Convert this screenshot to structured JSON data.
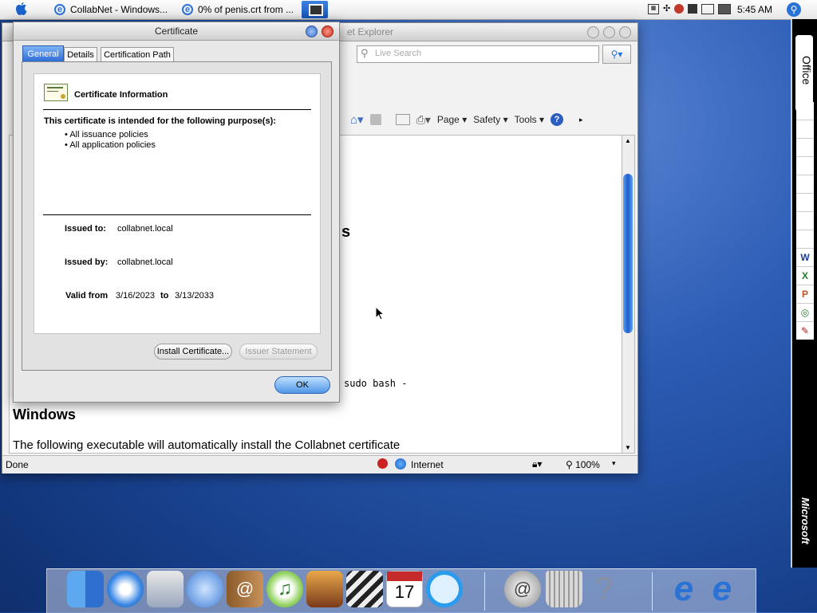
{
  "menubar": {
    "tabs": [
      {
        "label": "CollabNet - Windows..."
      },
      {
        "label": "0% of penis.crt from ..."
      }
    ],
    "clock": "5:45 AM"
  },
  "ie": {
    "title_fragment": "et Explorer",
    "search_placeholder": "Live Search",
    "toolbar": {
      "page": "Page",
      "safety": "Safety",
      "tools": "Tools"
    },
    "page": {
      "heading_fragment": "s",
      "code_fragment": "sudo bash -",
      "windows_heading": "Windows",
      "windows_text": "The following executable will automatically install the Collabnet certificate"
    },
    "status": {
      "left": "Done",
      "zone": "Internet",
      "zoom": "100%"
    }
  },
  "cert": {
    "title": "Certificate",
    "tabs": [
      "General",
      "Details",
      "Certification Path"
    ],
    "info_heading": "Certificate Information",
    "purpose_heading": "This certificate is intended for the following purpose(s):",
    "purposes": [
      "All issuance policies",
      "All application policies"
    ],
    "issued_to_label": "Issued to:",
    "issued_to": "collabnet.local",
    "issued_by_label": "Issued by:",
    "issued_by": "collabnet.local",
    "valid_from_label": "Valid from",
    "valid_from": "3/16/2023",
    "to_label": "to",
    "valid_to": "3/13/2033",
    "install_button": "Install Certificate...",
    "issuer_button": "Issuer Statement",
    "ok_button": "OK"
  },
  "office_bar": {
    "top_label": "Office",
    "bottom_label": "Microsoft"
  },
  "colors": {
    "accent": "#2a73d6",
    "desktop": "#2c5db5"
  }
}
